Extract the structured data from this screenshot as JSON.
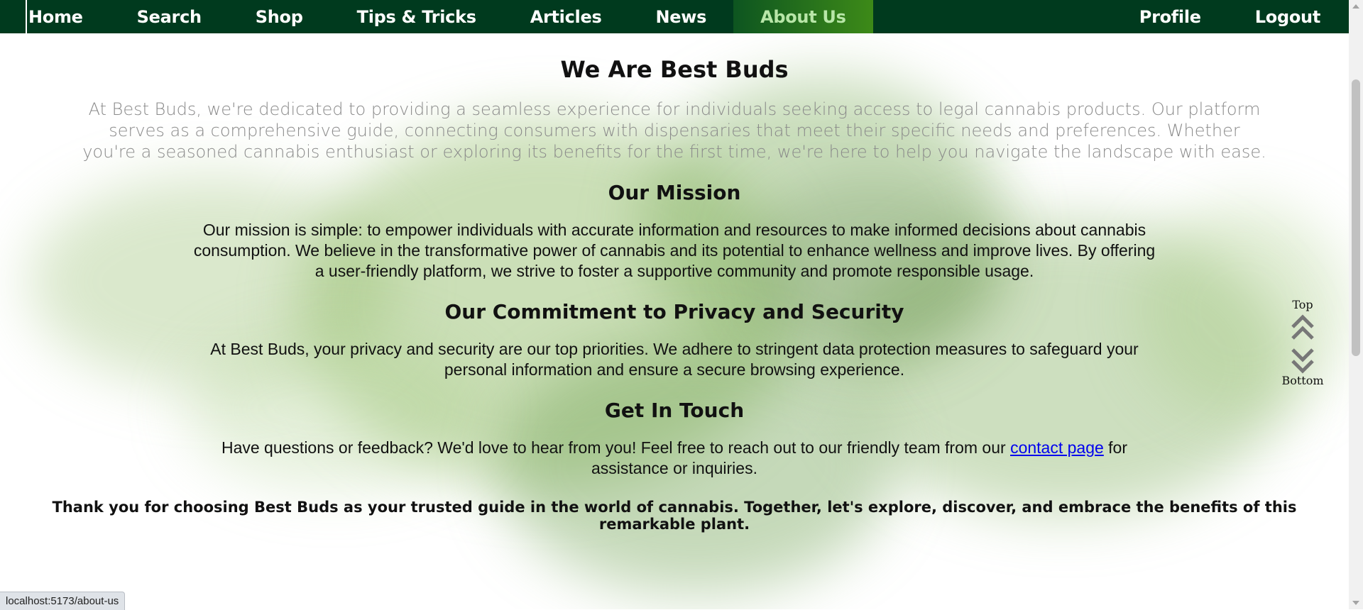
{
  "nav": {
    "left": [
      {
        "label": "Home"
      },
      {
        "label": "Search"
      },
      {
        "label": "Shop"
      },
      {
        "label": "Tips & Tricks"
      },
      {
        "label": "Articles"
      },
      {
        "label": "News"
      },
      {
        "label": "About Us",
        "active": true
      }
    ],
    "right": [
      {
        "label": "Profile"
      },
      {
        "label": "Logout"
      }
    ]
  },
  "page": {
    "title": "We Are Best Buds",
    "intro": "At Best Buds, we're dedicated to providing a seamless experience for individuals seeking access to legal cannabis products. Our platform serves as a comprehensive guide, connecting consumers with dispensaries that meet their specific needs and preferences. Whether you're a seasoned cannabis enthusiast or exploring its benefits for the first time, we're here to help you navigate the landscape with ease.",
    "mission": {
      "heading": "Our Mission",
      "body": "Our mission is simple: to empower individuals with accurate information and resources to make informed decisions about cannabis consumption. We believe in the transformative power of cannabis and its potential to enhance wellness and improve lives. By offering a user-friendly platform, we strive to foster a supportive community and promote responsible usage."
    },
    "privacy": {
      "heading": "Our Commitment to Privacy and Security",
      "body": "At Best Buds, your privacy and security are our top priorities. We adhere to stringent data protection measures to safeguard your personal information and ensure a secure browsing experience."
    },
    "contact": {
      "heading": "Get In Touch",
      "body_before": "Have questions or feedback? We'd love to hear from you! Feel free to reach out to our friendly team from our ",
      "link_text": "contact page",
      "body_after": " for assistance or inquiries."
    },
    "closing": "Thank you for choosing Best Buds as your trusted guide in the world of cannabis. Together, let's explore, discover, and embrace the benefits of this remarkable plant."
  },
  "scroll_widget": {
    "top_label": "Top",
    "bottom_label": "Bottom"
  },
  "status_bar": {
    "url": "localhost:5173/about-us"
  },
  "colors": {
    "nav_bg": "#003a1e",
    "nav_active_text": "#b8e6a8",
    "link": "#0000ee",
    "smoke_green": "#8fbf6a"
  }
}
